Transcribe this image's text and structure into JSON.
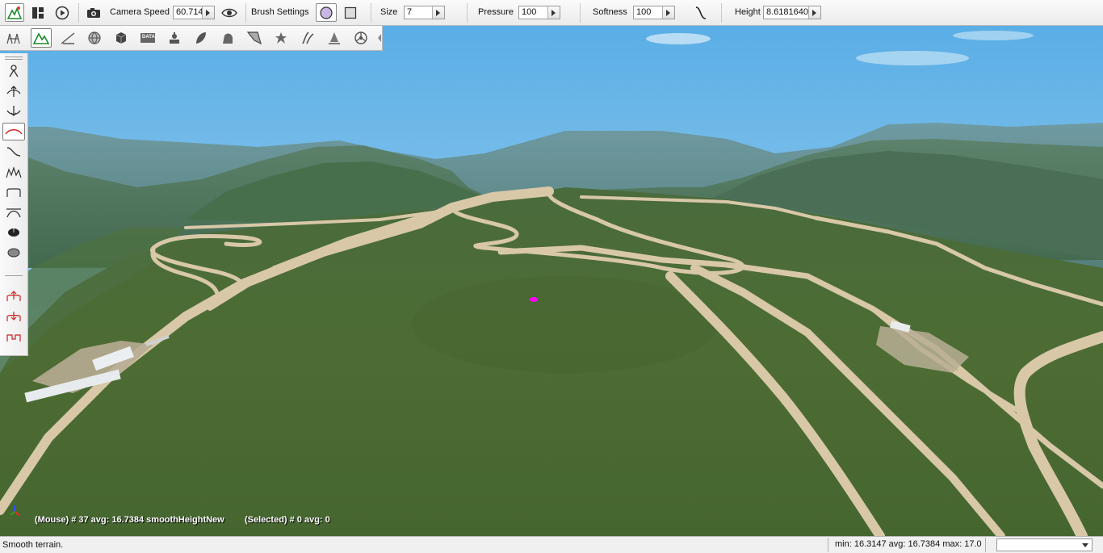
{
  "toolbar": {
    "camera_speed_label": "Camera Speed",
    "camera_speed_value": "60.714",
    "brush_settings_label": "Brush Settings",
    "size_label": "Size",
    "size_value": "7",
    "pressure_label": "Pressure",
    "pressure_value": "100",
    "softness_label": "Softness",
    "softness_value": "100",
    "height_label": "Height",
    "height_value": "8.6181640"
  },
  "toolbar2": {
    "data_icon_text": "DATA"
  },
  "viewport": {
    "mouse_info": "(Mouse) # 37  avg: 16.7384 smoothHeightNew",
    "selected_info": "(Selected) # 0  avg: 0"
  },
  "status": {
    "message": "Smooth terrain.",
    "stats": "min: 16.3147  avg: 16.7384  max: 17.0"
  },
  "colors": {
    "sky_top": "#64b4e8",
    "sky_bottom": "#b9dcf0",
    "grass": "#4b6a33",
    "road": "#d9c9aa",
    "marker": "#ff00ff"
  }
}
